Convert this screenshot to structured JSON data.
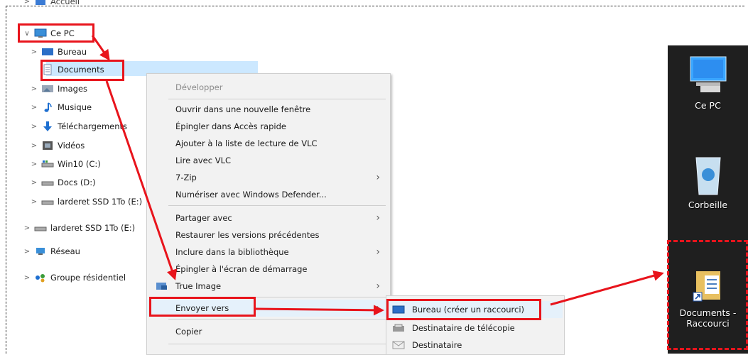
{
  "tree": {
    "items": [
      {
        "label": "Accueil",
        "icon": "star-folder-icon"
      },
      {
        "label": "Ce PC",
        "icon": "computer-icon"
      },
      {
        "label": "Bureau",
        "icon": "desktop-folder-icon"
      },
      {
        "label": "Documents",
        "icon": "document-icon"
      },
      {
        "label": "Images",
        "icon": "pictures-folder-icon"
      },
      {
        "label": "Musique",
        "icon": "music-icon"
      },
      {
        "label": "Téléchargements",
        "icon": "download-icon"
      },
      {
        "label": "Vidéos",
        "icon": "video-icon"
      },
      {
        "label": "Win10 (C:)",
        "icon": "drive-icon"
      },
      {
        "label": "Docs (D:)",
        "icon": "drive-icon"
      },
      {
        "label": "larderet SSD 1To (E:)",
        "icon": "drive-icon"
      },
      {
        "label": "larderet SSD 1To (E:)",
        "icon": "drive-icon"
      },
      {
        "label": "Réseau",
        "icon": "network-icon"
      },
      {
        "label": "Groupe résidentiel",
        "icon": "homegroup-icon"
      }
    ]
  },
  "context_menu": {
    "items": [
      {
        "label": "Développer",
        "disabled": true
      },
      {
        "label": "Ouvrir dans une nouvelle fenêtre"
      },
      {
        "label": "Épingler dans Accès rapide"
      },
      {
        "label": "Ajouter à la liste de lecture de VLC"
      },
      {
        "label": "Lire avec VLC"
      },
      {
        "label": "7-Zip",
        "submenu": true
      },
      {
        "label": "Numériser avec Windows Defender..."
      },
      {
        "label": "Partager avec",
        "submenu": true
      },
      {
        "label": "Restaurer les versions précédentes"
      },
      {
        "label": "Inclure dans la bibliothèque",
        "submenu": true
      },
      {
        "label": "Épingler à l'écran de démarrage"
      },
      {
        "label": "True Image",
        "submenu": true
      },
      {
        "label": "Envoyer vers",
        "submenu": true
      },
      {
        "label": "Copier"
      }
    ]
  },
  "send_to_submenu": {
    "items": [
      {
        "label": "Bureau (créer un raccourci)",
        "icon": "desktop-icon"
      },
      {
        "label": "Destinataire de télécopie",
        "icon": "fax-icon"
      },
      {
        "label": "Destinataire",
        "icon": "mail-icon"
      }
    ]
  },
  "desktop": {
    "icons": [
      {
        "label": "Ce PC",
        "icon": "computer-icon"
      },
      {
        "label": "Corbeille",
        "icon": "recycle-bin-icon"
      },
      {
        "label_line1": "Documents -",
        "label_line2": "Raccourci",
        "icon": "document-shortcut-icon"
      }
    ]
  },
  "colors": {
    "annotation_red": "#e8141c",
    "selection_blue": "#cce8ff",
    "menu_background": "#f2f2f2",
    "desktop_background": "#1f1f1f"
  }
}
